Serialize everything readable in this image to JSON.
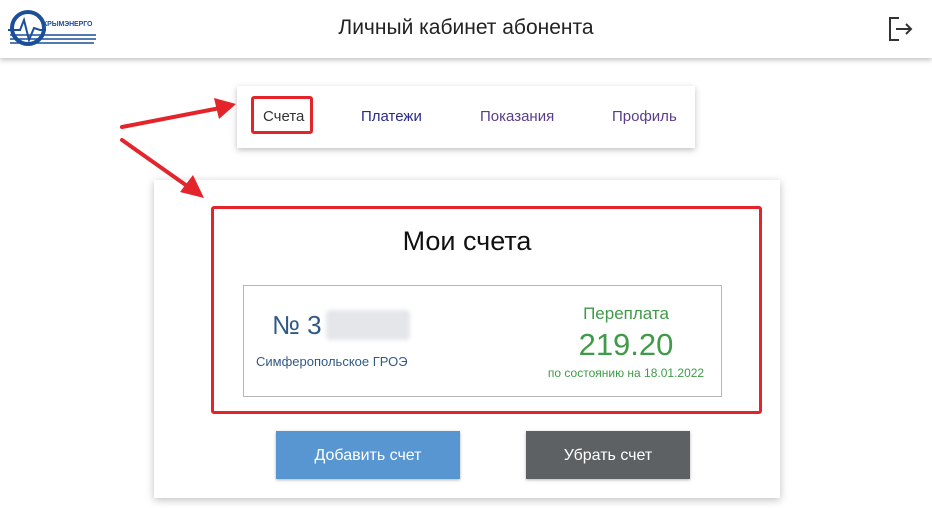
{
  "header": {
    "logo_text": "КРЫМЭНЕРГО",
    "title": "Личный кабинет абонента",
    "logout_icon": "logout-icon"
  },
  "tabs": [
    {
      "label": "Счета",
      "active": true
    },
    {
      "label": "Платежи"
    },
    {
      "label": "Показания"
    },
    {
      "label": "Профиль"
    }
  ],
  "card": {
    "title": "Мои счета",
    "account": {
      "number_prefix": "№ 3",
      "branch": "Симферопольское ГРОЭ"
    },
    "balance": {
      "status": "Переплата",
      "amount": "219.20",
      "date_note": "по состоянию на 18.01.2022"
    }
  },
  "buttons": {
    "add_account": "Добавить счет",
    "remove_account": "Убрать счет"
  },
  "colors": {
    "highlight": "#e3242b",
    "accent_blue": "#5896d1",
    "dark_button": "#5e6163",
    "balance_green": "#3f9b47",
    "account_blue": "#2f5a86"
  }
}
